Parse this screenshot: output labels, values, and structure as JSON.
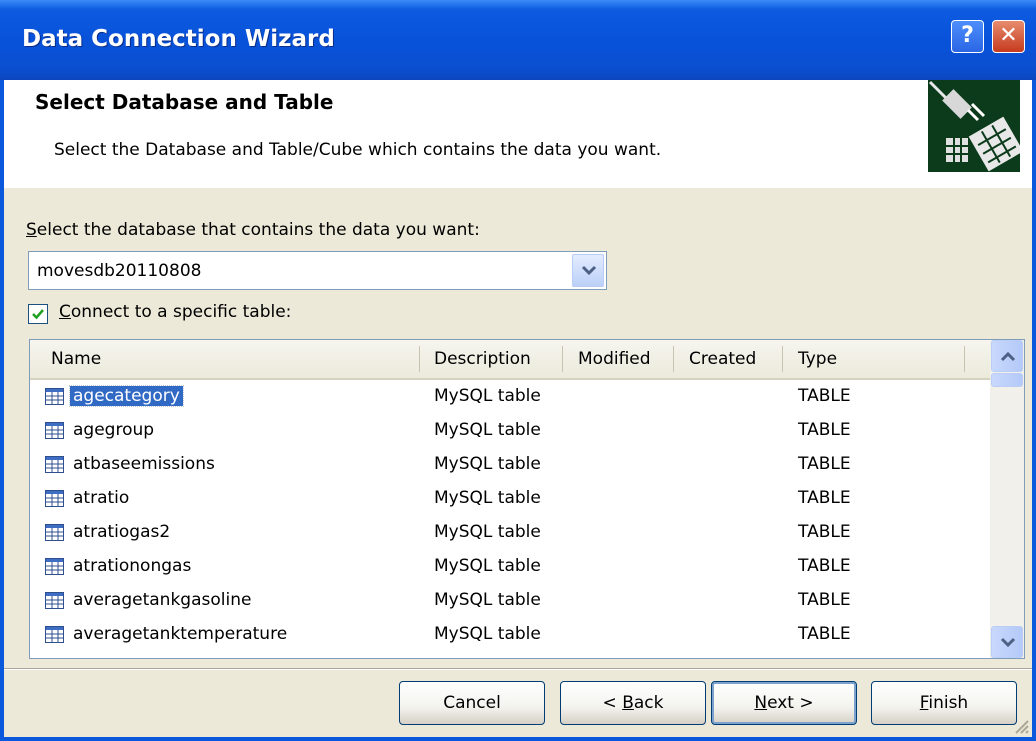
{
  "window": {
    "title": "Data Connection Wizard",
    "help_glyph": "?",
    "close_glyph": "✕"
  },
  "header": {
    "title": "Select Database and Table",
    "subtitle": "Select the Database and Table/Cube which contains the data you want."
  },
  "database": {
    "label_accel": "S",
    "label_rest": "elect the database that contains the data you want:",
    "selected": "movesdb20110808"
  },
  "specific_table": {
    "checked": true,
    "label_accel": "C",
    "label_rest": "onnect to a specific table:"
  },
  "table_list": {
    "columns": [
      "Name",
      "Description",
      "Modified",
      "Created",
      "Type"
    ],
    "rows": [
      {
        "name": "agecategory",
        "description": "MySQL table",
        "modified": "",
        "created": "",
        "type": "TABLE",
        "selected": true
      },
      {
        "name": "agegroup",
        "description": "MySQL table",
        "modified": "",
        "created": "",
        "type": "TABLE"
      },
      {
        "name": "atbaseemissions",
        "description": "MySQL table",
        "modified": "",
        "created": "",
        "type": "TABLE"
      },
      {
        "name": "atratio",
        "description": "MySQL table",
        "modified": "",
        "created": "",
        "type": "TABLE"
      },
      {
        "name": "atratiogas2",
        "description": "MySQL table",
        "modified": "",
        "created": "",
        "type": "TABLE"
      },
      {
        "name": "atrationongas",
        "description": "MySQL table",
        "modified": "",
        "created": "",
        "type": "TABLE"
      },
      {
        "name": "averagetankgasoline",
        "description": "MySQL table",
        "modified": "",
        "created": "",
        "type": "TABLE"
      },
      {
        "name": "averagetanktemperature",
        "description": "MySQL table",
        "modified": "",
        "created": "",
        "type": "TABLE"
      }
    ]
  },
  "buttons": {
    "cancel": "Cancel",
    "back_prefix": "< ",
    "back_accel": "B",
    "back_rest": "ack",
    "next_accel": "N",
    "next_rest": "ext >",
    "finish_accel": "F",
    "finish_rest": "inish"
  }
}
